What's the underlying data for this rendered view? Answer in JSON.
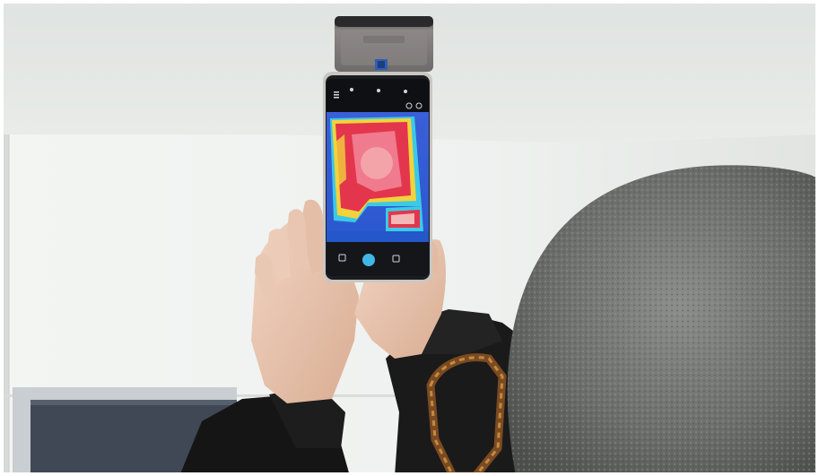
{
  "photo": {
    "subject": "thermal-imaging-phone-inspection",
    "colors": {
      "ceiling": "#e9ece9",
      "wall": "#eef1ef",
      "window_frame": "#3f4854",
      "phone_body": "#c9c6c2",
      "camera_module": "#3a3a3d",
      "thermal_hot": "#f3d23b",
      "thermal_warm": "#e3364d",
      "thermal_cool": "#2f6fe0",
      "thermal_cold": "#3bcae6",
      "beanie": "#6d706d",
      "jacket": "#151515",
      "skin": "#e8c6b1"
    }
  },
  "camera_module": {
    "brand_text": ""
  },
  "phone_app": {
    "top_icons": [
      "menu-icon",
      "temperature-icon",
      "mode-icon",
      "star-icon",
      "settings-icon"
    ],
    "bottom_controls": [
      "gallery-icon",
      "shutter-button",
      "video-icon"
    ],
    "bottom_labels": [
      "",
      "",
      ""
    ],
    "spot_readout": ""
  }
}
